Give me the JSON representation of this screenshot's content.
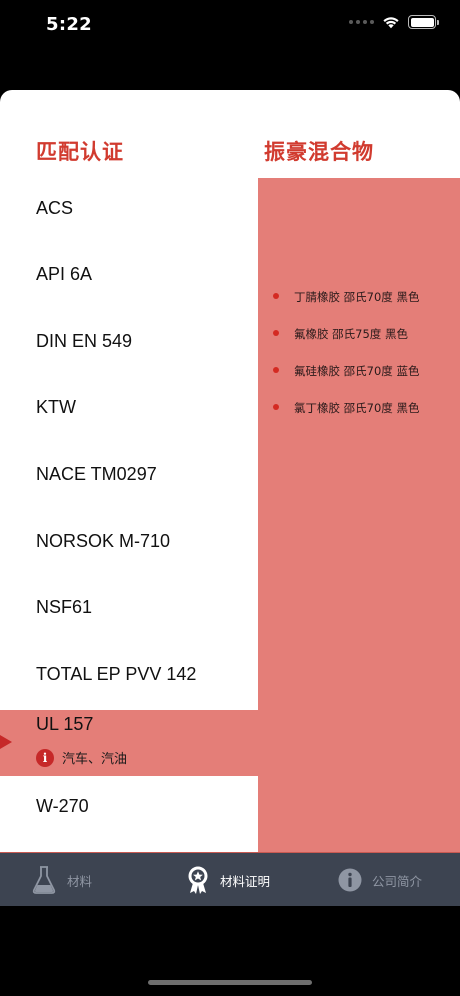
{
  "status": {
    "time": "5:22",
    "wifi_icon": "wifi-icon",
    "battery_icon": "battery-icon"
  },
  "titles": {
    "left": "匹配认证",
    "right": "振豪混合物"
  },
  "certifications": [
    {
      "label": "ACS"
    },
    {
      "label": "API 6A"
    },
    {
      "label": "DIN EN 549"
    },
    {
      "label": "KTW"
    },
    {
      "label": "NACE TM0297"
    },
    {
      "label": "NORSOK M-710"
    },
    {
      "label": "NSF61"
    },
    {
      "label": "TOTAL EP PVV 142"
    },
    {
      "label": "UL 157",
      "note": "汽车、汽油",
      "note_icon": "info-icon",
      "selected": true
    },
    {
      "label": "W-270"
    }
  ],
  "compounds": [
    {
      "label": "丁腈橡胶 邵氏70度 黑色"
    },
    {
      "label": "氟橡胶 邵氏75度 黑色"
    },
    {
      "label": "氟硅橡胶 邵氏70度 蓝色"
    },
    {
      "label": "氯丁橡胶 邵氏70度 黑色"
    }
  ],
  "tabs": [
    {
      "label": "材料",
      "icon": "flask-icon",
      "active": false
    },
    {
      "label": "材料证明",
      "icon": "award-ribbon-icon",
      "active": true
    },
    {
      "label": "公司简介",
      "icon": "info-icon",
      "active": false
    }
  ],
  "colors": {
    "accent_red": "#d13b2f",
    "panel_salmon": "#e47e78",
    "tab_bar": "#3d4451"
  }
}
